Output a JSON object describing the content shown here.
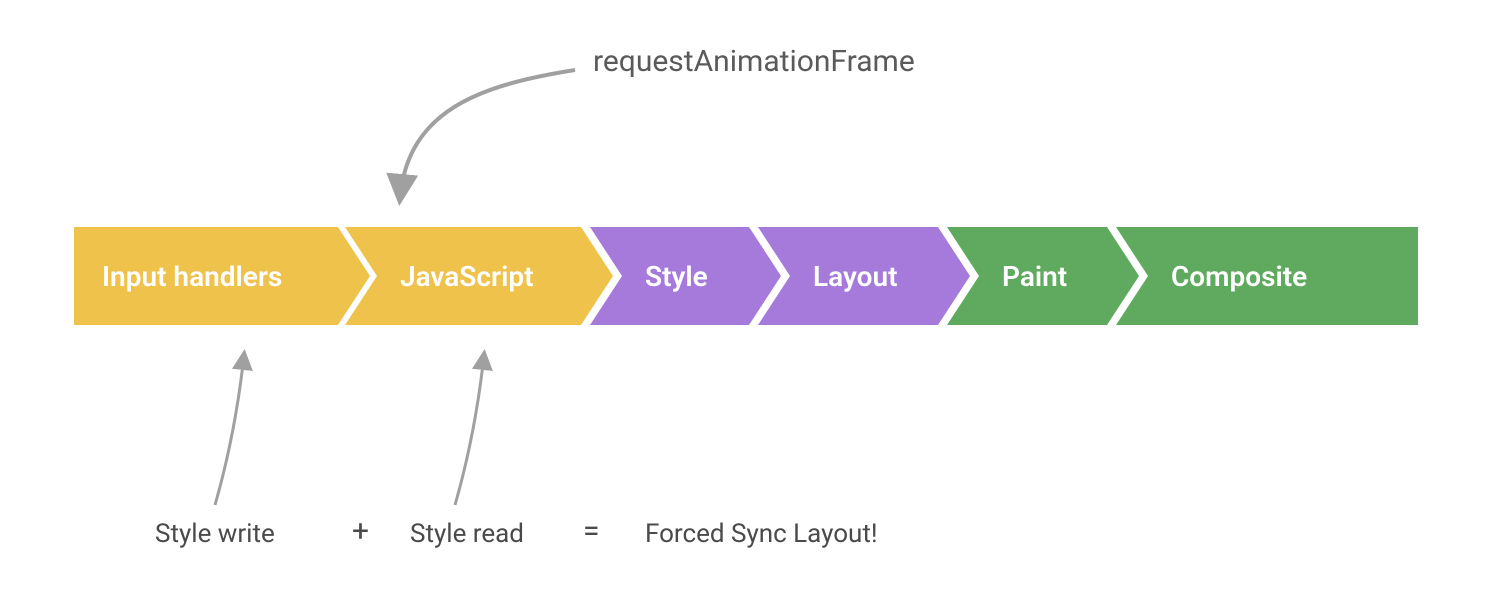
{
  "colors": {
    "yellow": "#eec24b",
    "purple": "#a67adb",
    "green": "#5faa5e",
    "arrow": "#a0a0a0",
    "text_dark": "#5a5a5a"
  },
  "top_annotation": {
    "label": "requestAnimationFrame"
  },
  "stages": [
    {
      "id": "input-handlers",
      "label": "Input handlers",
      "color": "yellow"
    },
    {
      "id": "javascript",
      "label": "JavaScript",
      "color": "yellow"
    },
    {
      "id": "style",
      "label": "Style",
      "color": "purple"
    },
    {
      "id": "layout",
      "label": "Layout",
      "color": "purple"
    },
    {
      "id": "paint",
      "label": "Paint",
      "color": "green"
    },
    {
      "id": "composite",
      "label": "Composite",
      "color": "green"
    }
  ],
  "bottom_equation": {
    "left": "Style write",
    "op1": "+",
    "middle": "Style read",
    "op2": "=",
    "right": "Forced Sync Layout!"
  }
}
